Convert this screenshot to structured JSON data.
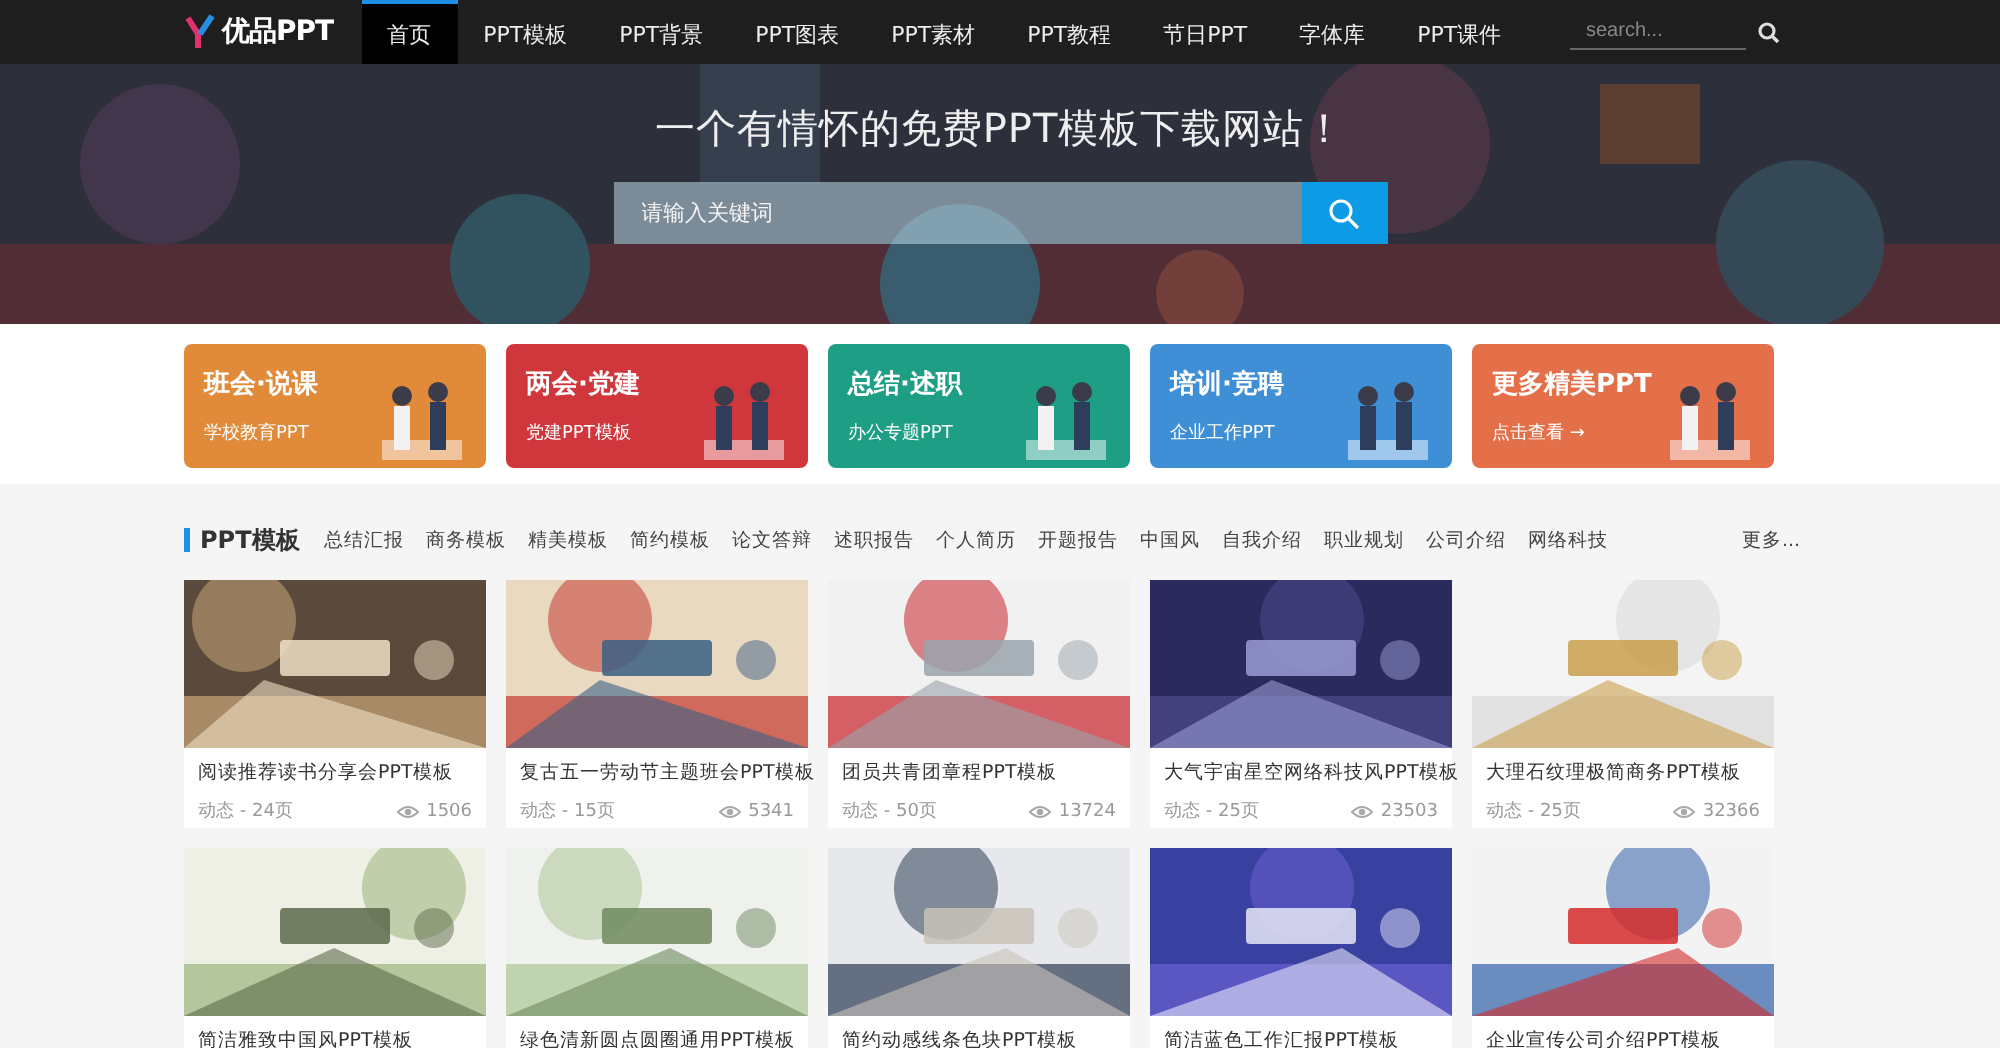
{
  "nav": {
    "logo": "优品PPT",
    "items": [
      {
        "label": "首页",
        "selected": true
      },
      {
        "label": "PPT模板",
        "selected": false
      },
      {
        "label": "PPT背景",
        "selected": false
      },
      {
        "label": "PPT图表",
        "selected": false
      },
      {
        "label": "PPT素材",
        "selected": false
      },
      {
        "label": "PPT教程",
        "selected": false
      },
      {
        "label": "节日PPT",
        "selected": false
      },
      {
        "label": "字体库",
        "selected": false
      },
      {
        "label": "PPT课件",
        "selected": false
      }
    ],
    "search": {
      "placeholder": "search..."
    }
  },
  "banner": {
    "headline": "一个有情怀的免费PPT模板下载网站！",
    "search": {
      "placeholder": "请输入关键词"
    }
  },
  "categories": [
    {
      "title": "班会·说课",
      "subtitle": "学校教育PPT",
      "color": "#e08a3a"
    },
    {
      "title": "两会·党建",
      "subtitle": "党建PPT模板",
      "color": "#d0373d"
    },
    {
      "title": "总结·述职",
      "subtitle": "办公专题PPT",
      "color": "#1f9e86"
    },
    {
      "title": "培训·竞聘",
      "subtitle": "企业工作PPT",
      "color": "#3f8fd6"
    },
    {
      "title": "更多精美PPT",
      "subtitle": "点击查看 →",
      "color": "#e4704a"
    }
  ],
  "section": {
    "title": "PPT模板",
    "tags": [
      "总结汇报",
      "商务模板",
      "精美模板",
      "简约模板",
      "论文答辩",
      "述职报告",
      "个人简历",
      "开题报告",
      "中国风",
      "自我介绍",
      "职业规划",
      "公司介绍",
      "网络科技"
    ],
    "more": "更多..."
  },
  "templates": [
    {
      "title": "阅读推荐读书分享会PPT模板",
      "meta": "动态 - 24页",
      "views": "1506"
    },
    {
      "title": "复古五一劳动节主题班会PPT模板",
      "meta": "动态 - 15页",
      "views": "5341"
    },
    {
      "title": "团员共青团章程PPT模板",
      "meta": "动态 - 50页",
      "views": "13724"
    },
    {
      "title": "大气宇宙星空网络科技风PPT模板",
      "meta": "动态 - 25页",
      "views": "23503"
    },
    {
      "title": "大理石纹理极简商务PPT模板",
      "meta": "动态 - 25页",
      "views": "32366"
    },
    {
      "title": "简洁雅致中国风PPT模板"
    },
    {
      "title": "绿色清新圆点圆圈通用PPT模板"
    },
    {
      "title": "简约动感线条色块PPT模板"
    },
    {
      "title": "简洁蓝色工作汇报PPT模板"
    },
    {
      "title": "企业宣传公司介绍PPT模板"
    }
  ]
}
